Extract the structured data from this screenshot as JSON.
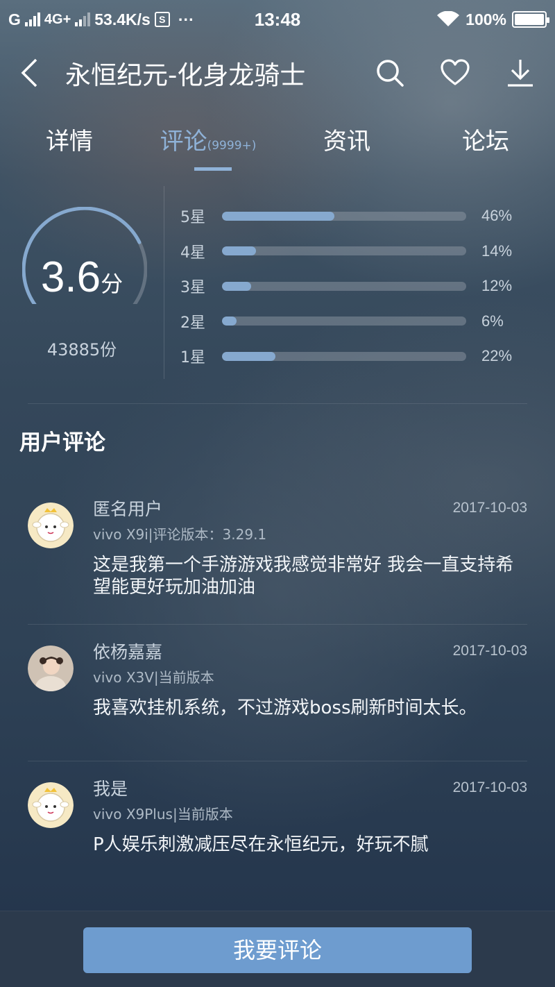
{
  "status_bar": {
    "carrier1": "G",
    "carrier2": "4G+",
    "speed": "53.4K/s",
    "s_badge": "S",
    "dots": "···",
    "time": "13:48",
    "battery": "100%"
  },
  "header": {
    "title": "永恒纪元-化身龙骑士"
  },
  "tabs": [
    {
      "label": "详情"
    },
    {
      "label": "评论",
      "count": "(9999+)"
    },
    {
      "label": "资讯"
    },
    {
      "label": "论坛"
    }
  ],
  "rating": {
    "score": "3.6",
    "score_unit": "分",
    "score_value": 3.6,
    "total": "43885份",
    "distribution": [
      {
        "label": "5星",
        "pct": "46%",
        "value": 46
      },
      {
        "label": "4星",
        "pct": "14%",
        "value": 14
      },
      {
        "label": "3星",
        "pct": "12%",
        "value": 12
      },
      {
        "label": "2星",
        "pct": "6%",
        "value": 6
      },
      {
        "label": "1星",
        "pct": "22%",
        "value": 22
      }
    ]
  },
  "section_title": "用户评论",
  "comments": [
    {
      "user": "匿名用户",
      "date": "2017-10-03",
      "device": "vivo X9i|评论版本：3.29.1",
      "text": "这是我第一个手游游戏我感觉非常好  我会一直支持希望能更好玩加油加油",
      "avatar": "sheep-avatar-icon"
    },
    {
      "user": "依杨嘉嘉",
      "date": "2017-10-03",
      "device": "vivo X3V|当前版本",
      "text": "我喜欢挂机系统，不过游戏boss刷新时间太长。",
      "avatar": "photo-avatar"
    },
    {
      "user": "我是",
      "date": "2017-10-03",
      "device": "vivo X9Plus|当前版本",
      "text": "P人娱乐刺激减压尽在永恒纪元，好玩不腻",
      "avatar": "sheep-avatar-icon"
    }
  ],
  "bottom": {
    "button_label": "我要评论"
  },
  "colors": {
    "accent": "#8fb2d8",
    "bar_fill": "#86a9cf",
    "button": "#6e9ccf"
  }
}
